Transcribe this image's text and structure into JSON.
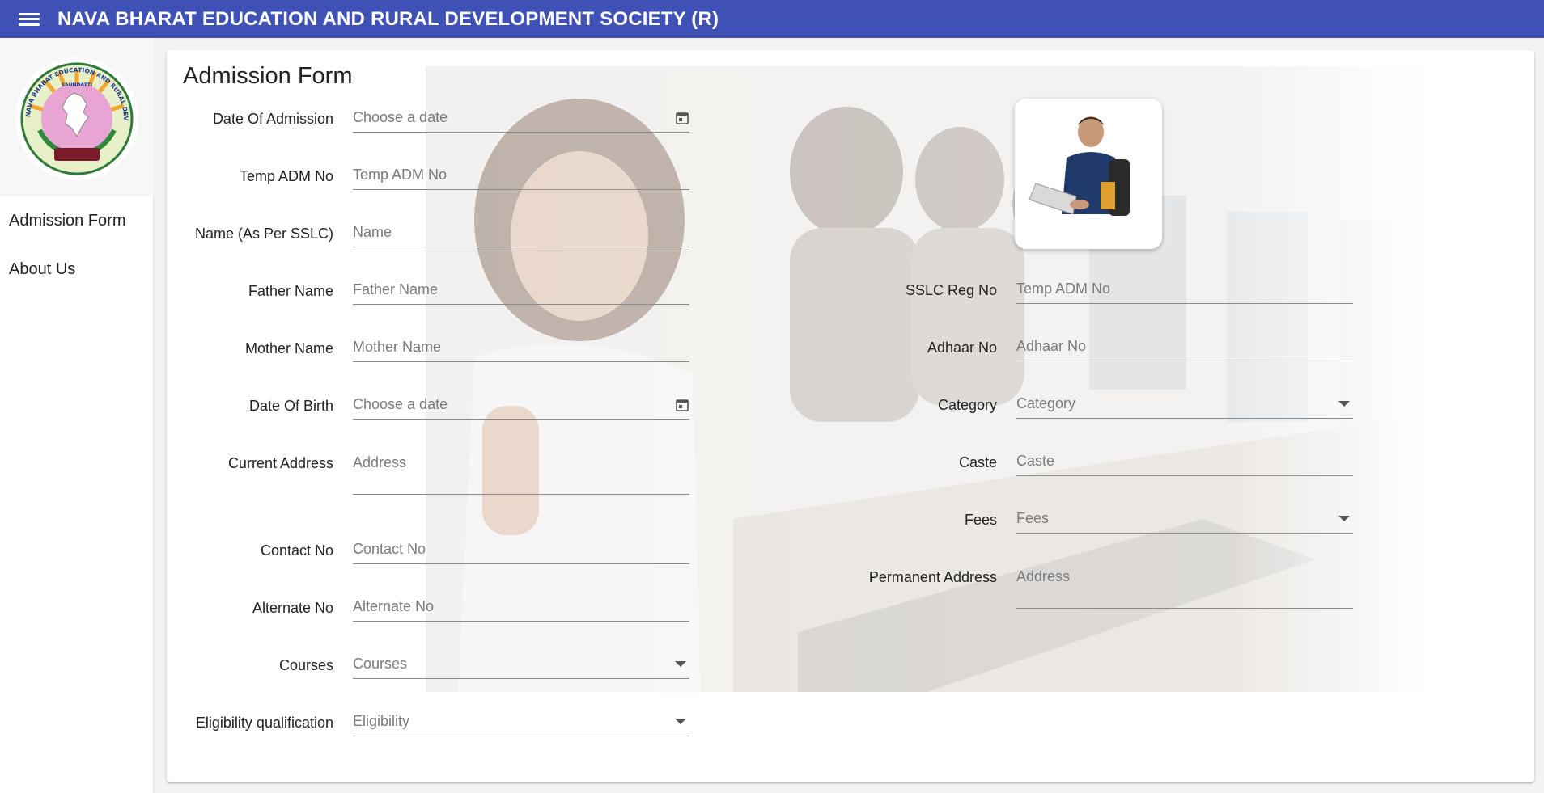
{
  "header": {
    "title": "NAVA BHARAT EDUCATION AND RURAL DEVELOPMENT SOCIETY (R)"
  },
  "sidebar": {
    "logo": {
      "ring_text": "NAVA BHARAT EDUCATION AND RURAL DEVELOPMENT SOCIETY (R)",
      "place": "SAUNDATTI"
    },
    "items": [
      {
        "label": "Admission Form"
      },
      {
        "label": "About Us"
      }
    ]
  },
  "form": {
    "title": "Admission Form",
    "left": [
      {
        "label": "Date Of Admission",
        "placeholder": "Choose a date",
        "type": "date"
      },
      {
        "label": "Temp ADM No",
        "placeholder": "Temp ADM No",
        "type": "text"
      },
      {
        "label": "Name (As Per SSLC)",
        "placeholder": "Name",
        "type": "text"
      },
      {
        "label": "Father Name",
        "placeholder": "Father Name",
        "type": "text"
      },
      {
        "label": "Mother Name",
        "placeholder": "Mother Name",
        "type": "text"
      },
      {
        "label": "Date Of Birth",
        "placeholder": "Choose a date",
        "type": "date"
      },
      {
        "label": "Current Address",
        "placeholder": "Address",
        "type": "textarea"
      },
      {
        "label": "Contact No",
        "placeholder": "Contact No",
        "type": "text"
      },
      {
        "label": "Alternate No",
        "placeholder": "Alternate No",
        "type": "text"
      },
      {
        "label": "Courses",
        "placeholder": "Courses",
        "type": "select"
      },
      {
        "label": "Eligibility qualification",
        "placeholder": "Eligibility",
        "type": "select"
      }
    ],
    "right": [
      {
        "label": "SSLC Reg No",
        "placeholder": "Temp ADM No",
        "type": "text"
      },
      {
        "label": "Adhaar No",
        "placeholder": "Adhaar No",
        "type": "text"
      },
      {
        "label": "Category",
        "placeholder": "Category",
        "type": "select"
      },
      {
        "label": "Caste",
        "placeholder": "Caste",
        "type": "text"
      },
      {
        "label": "Fees",
        "placeholder": "Fees",
        "type": "select"
      },
      {
        "label": "Permanent Address",
        "placeholder": "Address",
        "type": "textarea"
      }
    ]
  }
}
